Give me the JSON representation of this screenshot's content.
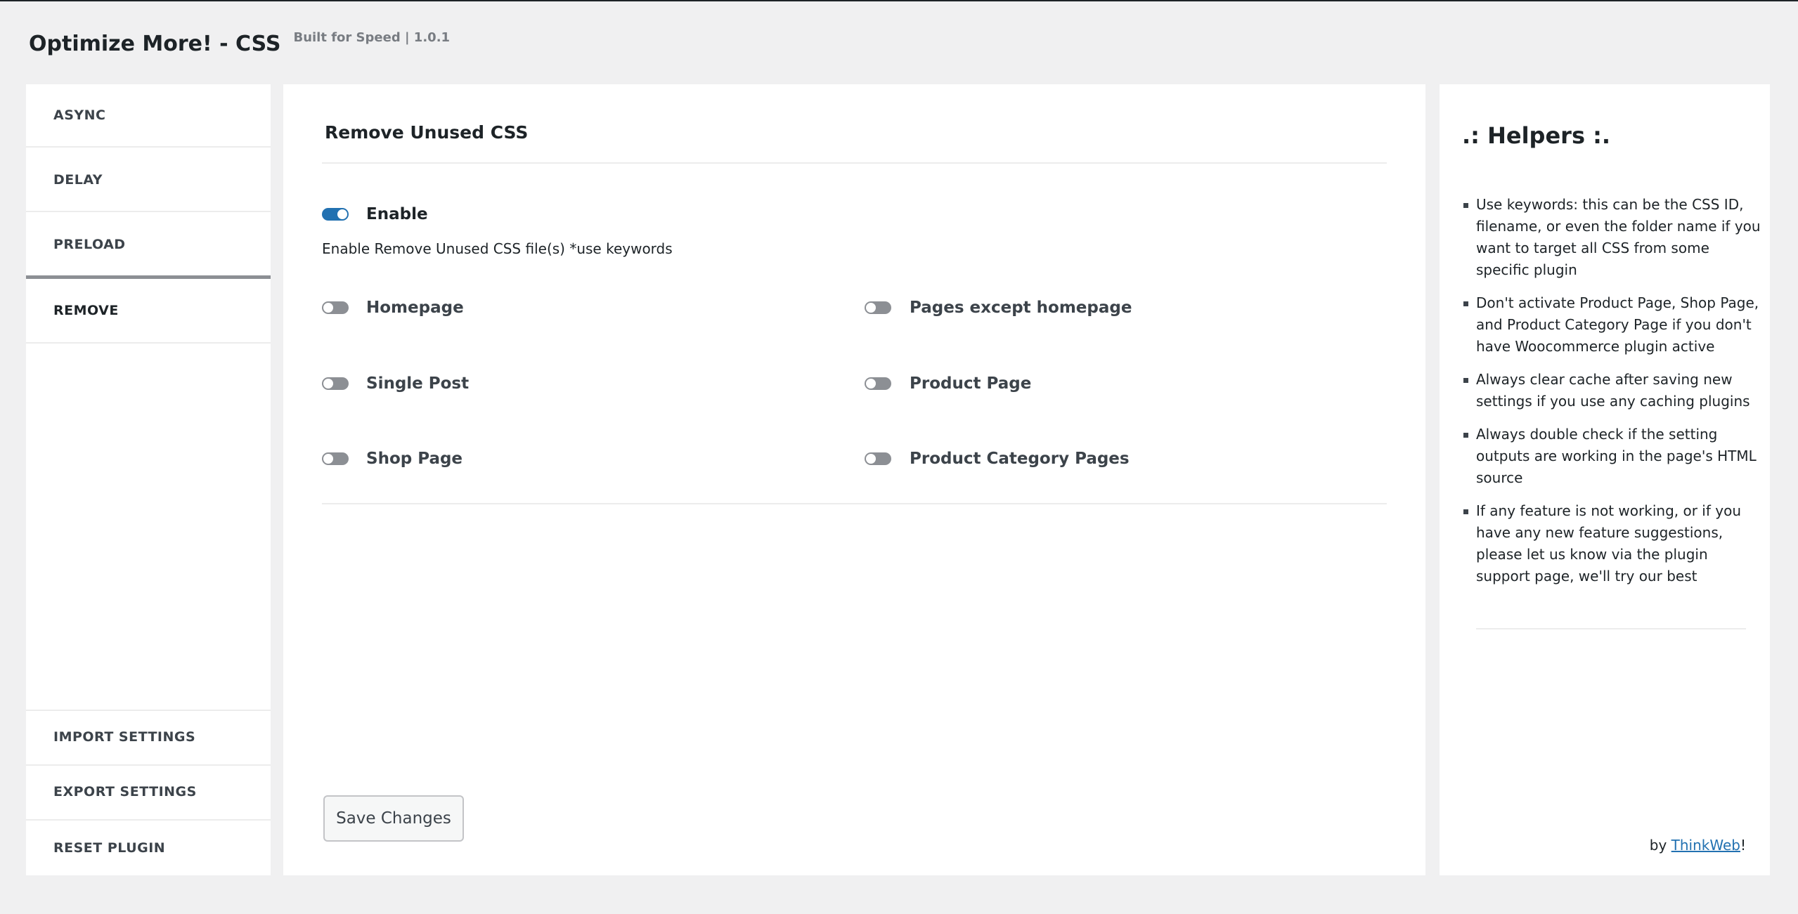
{
  "header": {
    "title": "Optimize More! - CSS",
    "subtitle": "Built for Speed | 1.0.1"
  },
  "sidebar": {
    "items": [
      {
        "label": "ASYNC",
        "active": false
      },
      {
        "label": "DELAY",
        "active": false
      },
      {
        "label": "PRELOAD",
        "active": false
      },
      {
        "label": "REMOVE",
        "active": true
      }
    ],
    "bottom_items": [
      {
        "label": "IMPORT SETTINGS"
      },
      {
        "label": "EXPORT SETTINGS"
      },
      {
        "label": "RESET PLUGIN"
      }
    ]
  },
  "main": {
    "section_title": "Remove Unused CSS",
    "enable": {
      "label": "Enable",
      "checked": true
    },
    "description": "Enable Remove Unused CSS file(s) *use keywords",
    "options": [
      {
        "label": "Homepage",
        "checked": false
      },
      {
        "label": "Pages except homepage",
        "checked": false
      },
      {
        "label": "Single Post",
        "checked": false
      },
      {
        "label": "Product Page",
        "checked": false
      },
      {
        "label": "Shop Page",
        "checked": false
      },
      {
        "label": "Product Category Pages",
        "checked": false
      }
    ],
    "save_label": "Save Changes"
  },
  "helpers": {
    "title": ".: Helpers :.",
    "items": [
      "Use keywords: this can be the CSS ID, filename, or even the folder name if you want to target all CSS from some specific plugin",
      "Don't activate Product Page, Shop Page, and Product Category Page if you don't have Woocommerce plugin active",
      "Always clear cache after saving new settings if you use any caching plugins",
      "Always double check if the setting outputs are working in the page's HTML source",
      "If any feature is not working, or if you have any new feature suggestions, please let us know via the plugin support page, we'll try our best"
    ],
    "credit_prefix": "by ",
    "credit_link": "ThinkWeb",
    "credit_suffix": "!"
  },
  "colors": {
    "background": "#f0f0f1",
    "panel": "#ffffff",
    "toggle_on": "#2271b1",
    "toggle_off": "#8c8f94",
    "link": "#2271b1"
  }
}
